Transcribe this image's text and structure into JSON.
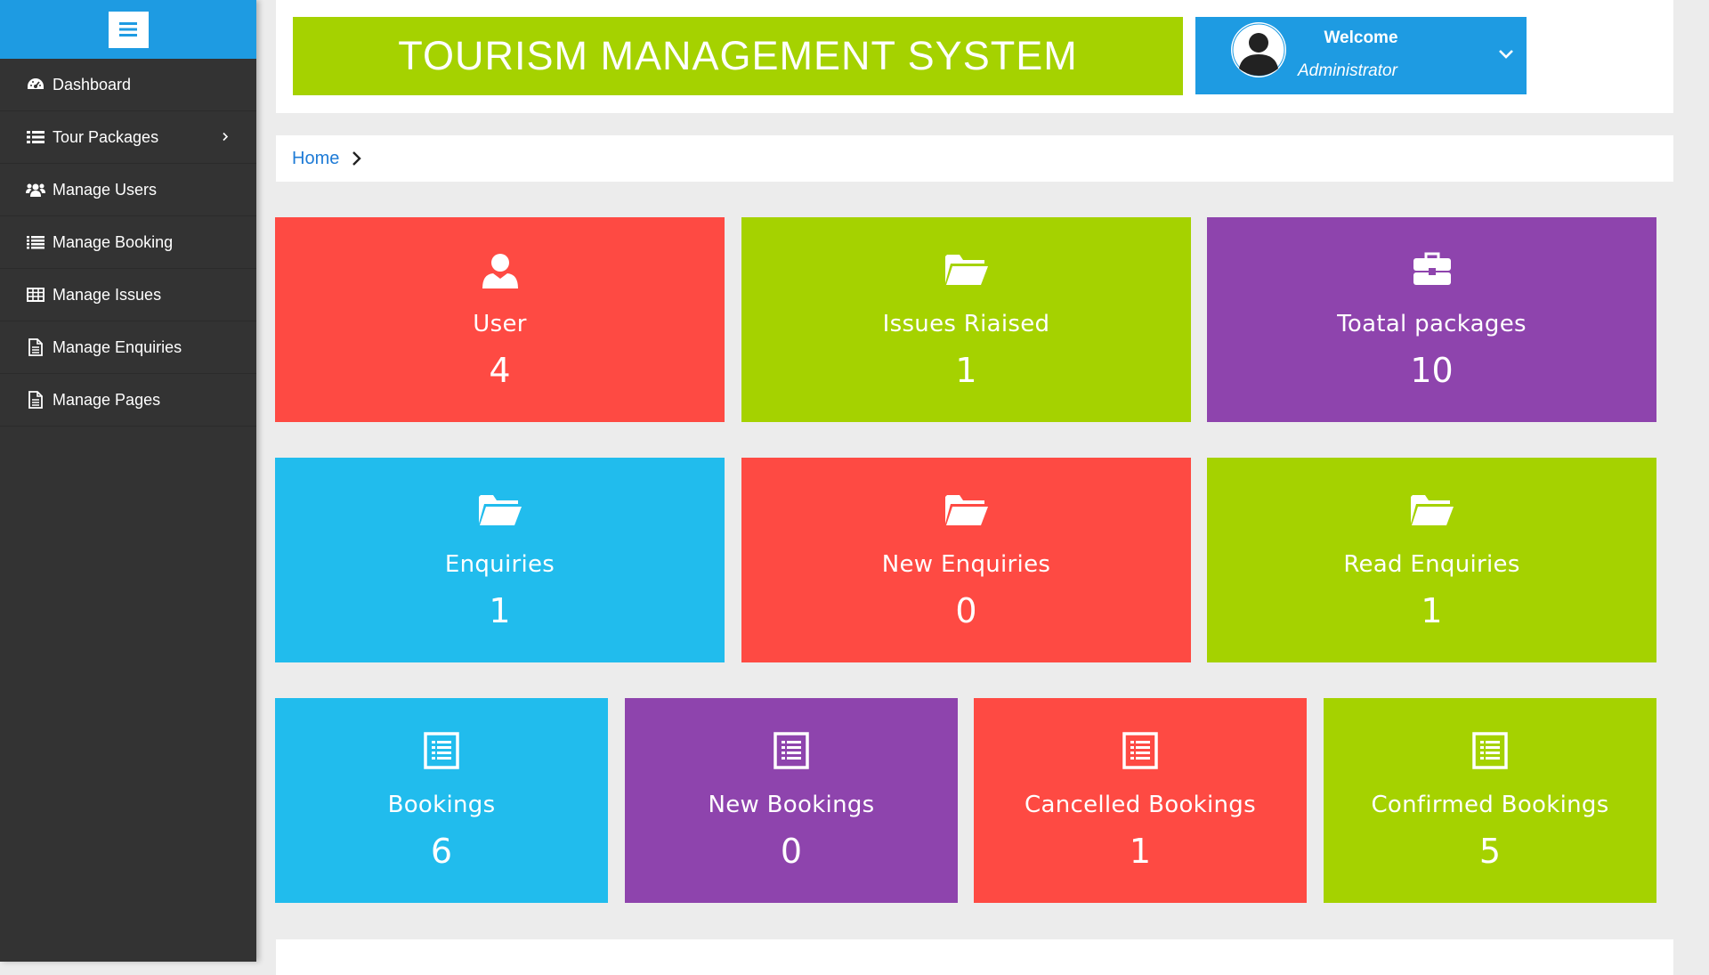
{
  "colors": {
    "sidebar_bg": "#333333",
    "accent_blue": "#1e9be2",
    "green": "#a5d200",
    "red": "#fe4a43",
    "purple": "#8e44ad",
    "cyan": "#21bced"
  },
  "sidebar": {
    "toggle_icon": "hamburger-icon",
    "items": [
      {
        "label": "Dashboard",
        "icon": "dashboard-icon"
      },
      {
        "label": "Tour Packages",
        "icon": "list-icon",
        "has_submenu": true
      },
      {
        "label": "Manage Users",
        "icon": "users-icon"
      },
      {
        "label": "Manage Booking",
        "icon": "list-icon"
      },
      {
        "label": "Manage Issues",
        "icon": "table-icon"
      },
      {
        "label": "Manage Enquiries",
        "icon": "file-icon"
      },
      {
        "label": "Manage Pages",
        "icon": "file-icon"
      }
    ]
  },
  "header": {
    "title": "TOURISM MANAGEMENT SYSTEM",
    "welcome": "Welcome",
    "role": "Administrator"
  },
  "breadcrumb": {
    "home": "Home"
  },
  "tiles": [
    {
      "label": "User",
      "count": "4",
      "icon": "user-icon",
      "color": "#fe4a43"
    },
    {
      "label": "Issues Riaised",
      "count": "1",
      "icon": "folder-open-icon",
      "color": "#a5d200"
    },
    {
      "label": "Toatal packages",
      "count": "10",
      "icon": "briefcase-icon",
      "color": "#8e44ad"
    },
    {
      "label": "Enquiries",
      "count": "1",
      "icon": "folder-open-icon",
      "color": "#21bced"
    },
    {
      "label": "New Enquiries",
      "count": "0",
      "icon": "folder-open-icon",
      "color": "#fe4a43"
    },
    {
      "label": "Read Enquiries",
      "count": "1",
      "icon": "folder-open-icon",
      "color": "#a5d200"
    },
    {
      "label": "Bookings",
      "count": "6",
      "icon": "list-alt-icon",
      "color": "#21bced"
    },
    {
      "label": "New Bookings",
      "count": "0",
      "icon": "list-alt-icon",
      "color": "#8e44ad"
    },
    {
      "label": "Cancelled Bookings",
      "count": "1",
      "icon": "list-alt-icon",
      "color": "#fe4a43"
    },
    {
      "label": "Confirmed Bookings",
      "count": "5",
      "icon": "list-alt-icon",
      "color": "#a5d200"
    }
  ]
}
